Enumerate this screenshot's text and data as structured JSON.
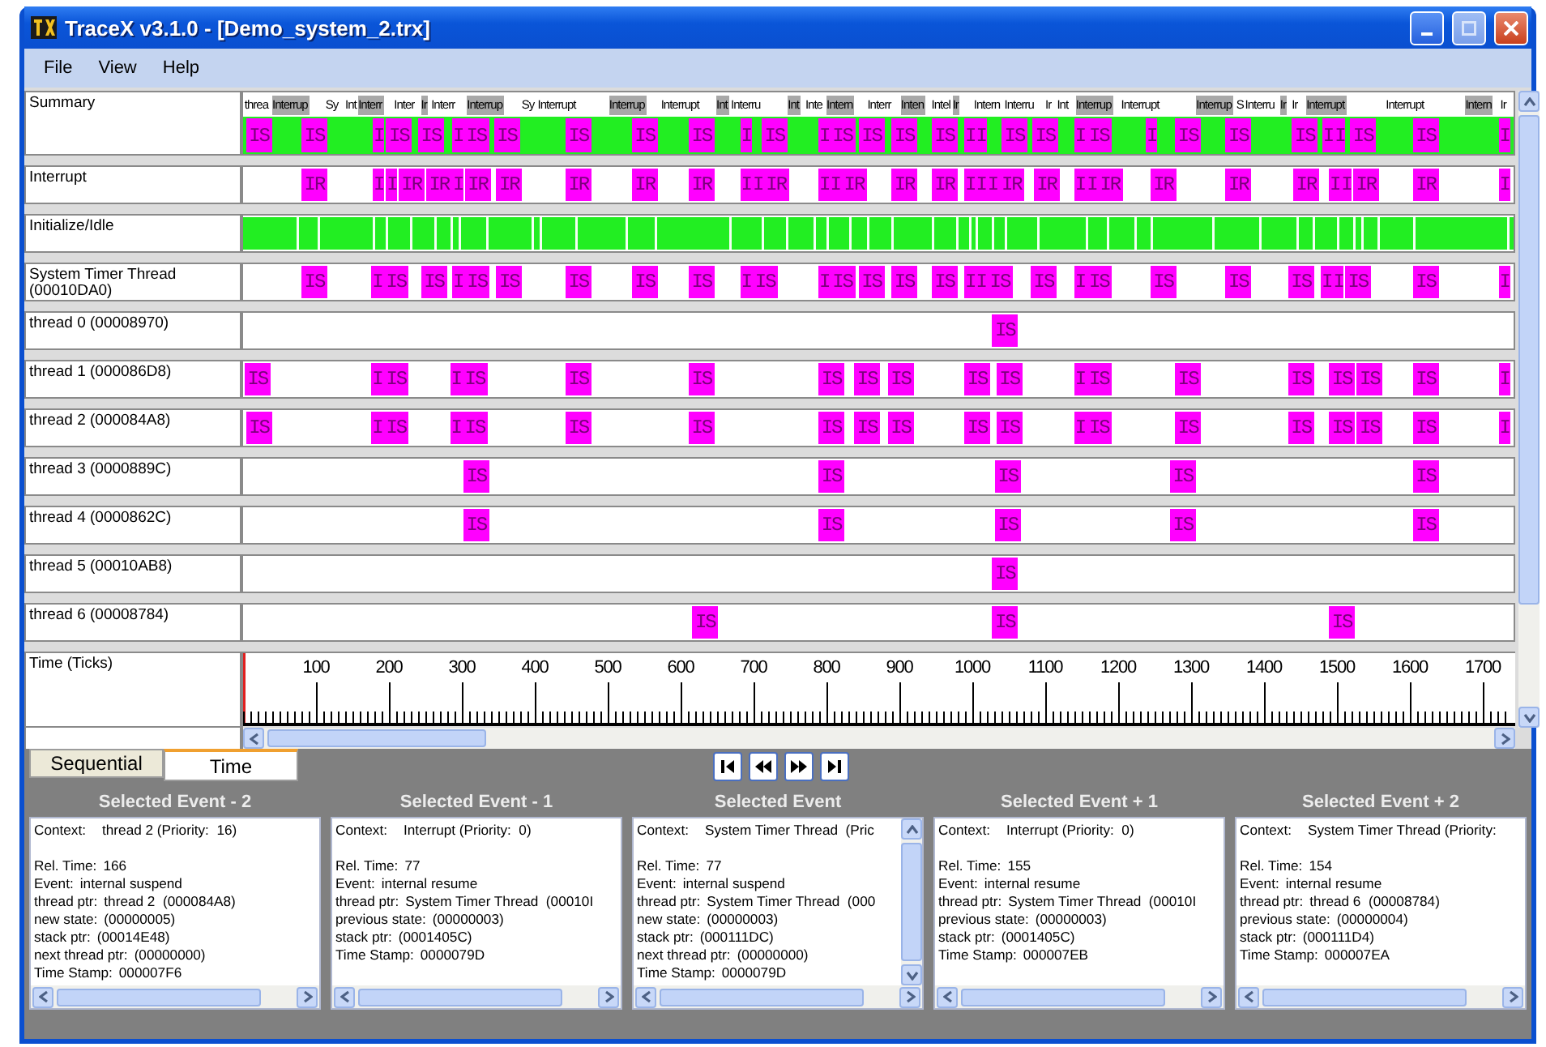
{
  "window": {
    "title": "TraceX v3.1.0 - [Demo_system_2.trx]"
  },
  "menu": [
    "File",
    "View",
    "Help"
  ],
  "rows": [
    {
      "kind": "summary",
      "label": "Summary",
      "headers": [
        {
          "text": "threa",
          "shaded": false
        },
        {
          "text": "Interrup",
          "shaded": true
        },
        {
          "text": "Sy",
          "shaded": false
        },
        {
          "text": "Int",
          "shaded": false
        },
        {
          "text": "Interr",
          "shaded": true
        },
        {
          "text": "Inter",
          "shaded": false
        },
        {
          "text": "Ir",
          "shaded": true
        },
        {
          "text": "Interr",
          "shaded": false
        },
        {
          "text": "Interrup",
          "shaded": true
        },
        {
          "text": "Sy",
          "shaded": false
        },
        {
          "text": "Interrupt",
          "shaded": false
        },
        {
          "text": "Interrup",
          "shaded": true
        },
        {
          "text": "Interrupt",
          "shaded": false
        },
        {
          "text": "Int",
          "shaded": true
        },
        {
          "text": "Interru",
          "shaded": false
        },
        {
          "text": "Int",
          "shaded": true
        },
        {
          "text": "Inte",
          "shaded": false
        },
        {
          "text": "Intern",
          "shaded": true
        },
        {
          "text": "Interr",
          "shaded": false
        },
        {
          "text": "Inten",
          "shaded": true
        },
        {
          "text": "Intel",
          "shaded": false
        },
        {
          "text": "Ir",
          "shaded": true
        },
        {
          "text": "Intern",
          "shaded": false
        },
        {
          "text": "Interru",
          "shaded": false
        },
        {
          "text": "Ir",
          "shaded": false
        },
        {
          "text": "Int",
          "shaded": false
        },
        {
          "text": "Interrup",
          "shaded": true
        },
        {
          "text": "Interrupt",
          "shaded": false
        },
        {
          "text": "Interrup",
          "shaded": true
        },
        {
          "text": "S",
          "shaded": false
        },
        {
          "text": "Interru",
          "shaded": false
        },
        {
          "text": "Ir",
          "shaded": true
        },
        {
          "text": "Ir",
          "shaded": false
        },
        {
          "text": "Interrupt",
          "shaded": true
        },
        {
          "text": "Interrupt",
          "shaded": false
        },
        {
          "text": "Intern",
          "shaded": true
        },
        {
          "text": "Ir",
          "shaded": false
        }
      ],
      "events": [
        "IS",
        "IS",
        "I",
        "IS",
        "IS",
        "I",
        "IS",
        "IS",
        "IS",
        "IS",
        "IS",
        "I",
        "IS",
        "I",
        "IS",
        "IS",
        "IS",
        "IS",
        "I",
        "I",
        "IS",
        "IS",
        "I",
        "IS",
        "I",
        "IS",
        "IS",
        "IS",
        "I",
        "I",
        "IS",
        "IS",
        "I"
      ]
    },
    {
      "kind": "events",
      "label": "Interrupt",
      "events": [
        "IR",
        "I",
        "I",
        "IR",
        "IR",
        "I",
        "IR",
        "IR",
        "IR",
        "IR",
        "IR",
        "I",
        "I",
        "IR",
        "I",
        "I",
        "IR",
        "IR",
        "IR",
        "I",
        "I",
        "I",
        "IR",
        "IR",
        "I",
        "I",
        "IR",
        "IR",
        "IR",
        "IR",
        "I",
        "I",
        "IR",
        "IR",
        "I"
      ]
    },
    {
      "kind": "idle",
      "label": "Initialize/Idle"
    },
    {
      "kind": "events",
      "label": "System Timer Thread (00010DA0)",
      "events": [
        "IS",
        "I",
        "IS",
        "IS",
        "I",
        "IS",
        "IS",
        "IS",
        "IS",
        "IS",
        "I",
        "IS",
        "I",
        "IS",
        "IS",
        "IS",
        "IS",
        "I",
        "I",
        "IS",
        "IS",
        "I",
        "IS",
        "IS",
        "IS",
        "IS",
        "I",
        "I",
        "IS",
        "IS",
        "I"
      ]
    },
    {
      "kind": "events",
      "label": "thread 0 (00008970)",
      "events": [
        "IS"
      ]
    },
    {
      "kind": "events",
      "label": "thread 1 (000086D8)",
      "events": [
        "IS",
        "I",
        "IS",
        "I",
        "IS",
        "IS",
        "IS",
        "IS",
        "IS",
        "IS",
        "IS",
        "IS",
        "I",
        "IS",
        "IS",
        "IS",
        "IS",
        "IS",
        "IS",
        "I"
      ]
    },
    {
      "kind": "events",
      "label": "thread 2 (000084A8)",
      "events": [
        "IS",
        "I",
        "IS",
        "I",
        "IS",
        "IS",
        "IS",
        "IS",
        "IS",
        "IS",
        "IS",
        "IS",
        "I",
        "IS",
        "IS",
        "IS",
        "IS",
        "IS",
        "IS",
        "I"
      ]
    },
    {
      "kind": "events",
      "label": "thread 3 (0000889C)",
      "events": [
        "IS",
        "IS",
        "IS",
        "IS",
        "IS"
      ]
    },
    {
      "kind": "events",
      "label": "thread 4 (0000862C)",
      "events": [
        "IS",
        "IS",
        "IS",
        "IS",
        "IS"
      ]
    },
    {
      "kind": "events",
      "label": "thread 5 (00010AB8)",
      "events": [
        "IS"
      ]
    },
    {
      "kind": "events",
      "label": "thread 6 (00008784)",
      "events": [
        "IS",
        "IS",
        "IS"
      ]
    }
  ],
  "time_axis": {
    "label": "Time (Ticks)",
    "ticks": [
      "100",
      "200",
      "300",
      "400",
      "500",
      "600",
      "700",
      "800",
      "900",
      "1000",
      "1100",
      "1200",
      "1300",
      "1400",
      "1500",
      "1600",
      "1700"
    ]
  },
  "tabs": [
    {
      "label": "Sequential",
      "selected": false
    },
    {
      "label": "Time",
      "selected": true
    }
  ],
  "nav_buttons": [
    {
      "kind": "first"
    },
    {
      "kind": "previous"
    },
    {
      "kind": "next"
    },
    {
      "kind": "last"
    }
  ],
  "panels": [
    {
      "title": "Selected Event - 2",
      "vertical_scroll": false,
      "fields": [
        {
          "label": "Context:",
          "value": "thread 2 (Priority:  16)"
        },
        {
          "label": "Rel. Time:",
          "value": "166"
        },
        {
          "label": "Event:",
          "value": "internal suspend"
        },
        {
          "label": "thread ptr:",
          "value": "thread 2  (000084A8)"
        },
        {
          "label": "new state:",
          "value": "(00000005)"
        },
        {
          "label": "stack ptr:",
          "value": "(00014E48)"
        },
        {
          "label": "next thread ptr:",
          "value": "(00000000)"
        },
        {
          "label": "Time Stamp:",
          "value": "000007F6"
        }
      ]
    },
    {
      "title": "Selected Event - 1",
      "vertical_scroll": false,
      "fields": [
        {
          "label": "Context:",
          "value": "Interrupt (Priority:  0)"
        },
        {
          "label": "Rel. Time:",
          "value": "77"
        },
        {
          "label": "Event:",
          "value": "internal resume"
        },
        {
          "label": "thread ptr:",
          "value": "System Timer Thread  (00010I"
        },
        {
          "label": "previous state:",
          "value": "(00000003)"
        },
        {
          "label": "stack ptr:",
          "value": "(0001405C)"
        },
        {
          "label": "Time Stamp:",
          "value": "0000079D"
        }
      ]
    },
    {
      "title": "Selected Event",
      "vertical_scroll": true,
      "fields": [
        {
          "label": "Context:",
          "value": "System Timer Thread  (Pric"
        },
        {
          "label": "Rel. Time:",
          "value": "77"
        },
        {
          "label": "Event:",
          "value": "internal suspend"
        },
        {
          "label": "thread ptr:",
          "value": "System Timer Thread  (000"
        },
        {
          "label": "new state:",
          "value": "(00000003)"
        },
        {
          "label": "stack ptr:",
          "value": "(000111DC)"
        },
        {
          "label": "next thread ptr:",
          "value": "(00000000)"
        },
        {
          "label": "Time Stamp:",
          "value": "0000079D"
        }
      ]
    },
    {
      "title": "Selected Event + 1",
      "vertical_scroll": false,
      "fields": [
        {
          "label": "Context:",
          "value": "Interrupt (Priority:  0)"
        },
        {
          "label": "Rel. Time:",
          "value": "155"
        },
        {
          "label": "Event:",
          "value": "internal resume"
        },
        {
          "label": "thread ptr:",
          "value": "System Timer Thread  (00010I"
        },
        {
          "label": "previous state:",
          "value": "(00000003)"
        },
        {
          "label": "stack ptr:",
          "value": "(0001405C)"
        },
        {
          "label": "Time Stamp:",
          "value": "000007EB"
        }
      ]
    },
    {
      "title": "Selected Event + 2",
      "vertical_scroll": false,
      "fields": [
        {
          "label": "Context:",
          "value": "System Timer Thread (Priority:"
        },
        {
          "label": "Rel. Time:",
          "value": "154"
        },
        {
          "label": "Event:",
          "value": "internal resume"
        },
        {
          "label": "thread ptr:",
          "value": "thread 6  (00008784)"
        },
        {
          "label": "previous state:",
          "value": "(00000004)"
        },
        {
          "label": "stack ptr:",
          "value": "(000111D4)"
        },
        {
          "label": "Time Stamp:",
          "value": "000007EA"
        }
      ]
    }
  ]
}
